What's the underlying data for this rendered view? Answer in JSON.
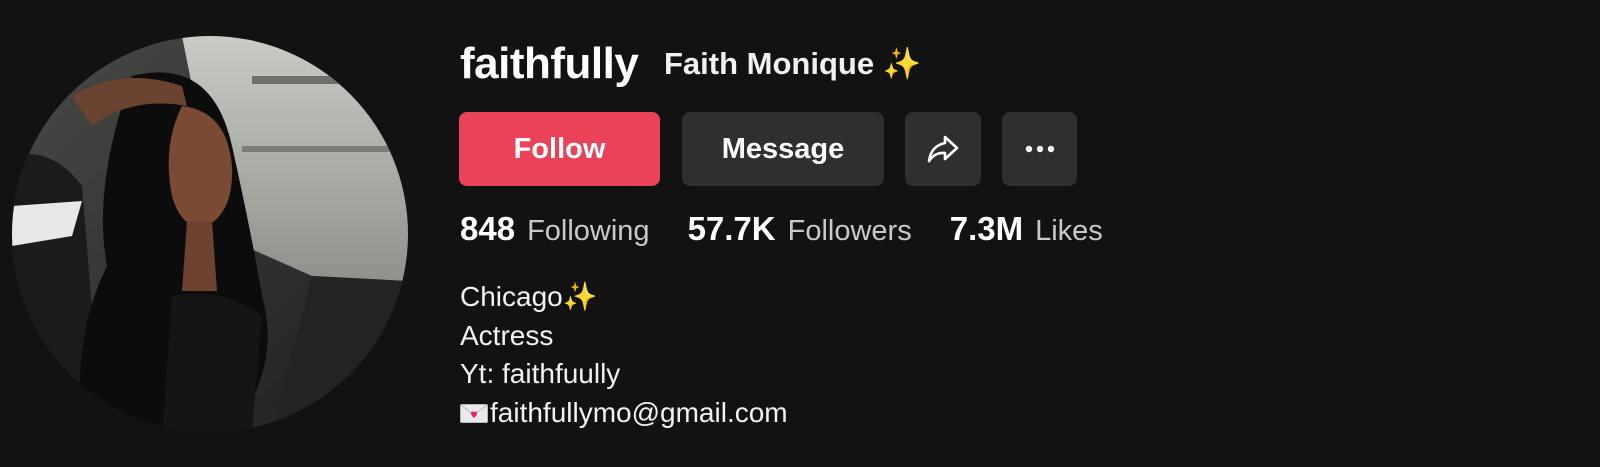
{
  "profile": {
    "username": "faithfully",
    "display_name": "Faith Monique",
    "display_name_emoji": "✨",
    "avatar_icon": "avatar-photo"
  },
  "actions": {
    "follow_label": "Follow",
    "message_label": "Message",
    "share_icon": "share-icon",
    "more_icon": "more-icon"
  },
  "stats": [
    {
      "value": "848",
      "label": "Following"
    },
    {
      "value": "57.7K",
      "label": "Followers"
    },
    {
      "value": "7.3M",
      "label": "Likes"
    }
  ],
  "bio": {
    "line1": "Chicago",
    "line1_emoji": "✨",
    "line2": "Actress",
    "line3": "Yt: faithfuully",
    "line4": "faithfullymo@gmail.com",
    "line4_icon": "love-letter-icon"
  },
  "colors": {
    "background": "#121212",
    "follow": "#ea4259",
    "secondary_button": "#2f2f2f",
    "accent": "#f6c945"
  }
}
